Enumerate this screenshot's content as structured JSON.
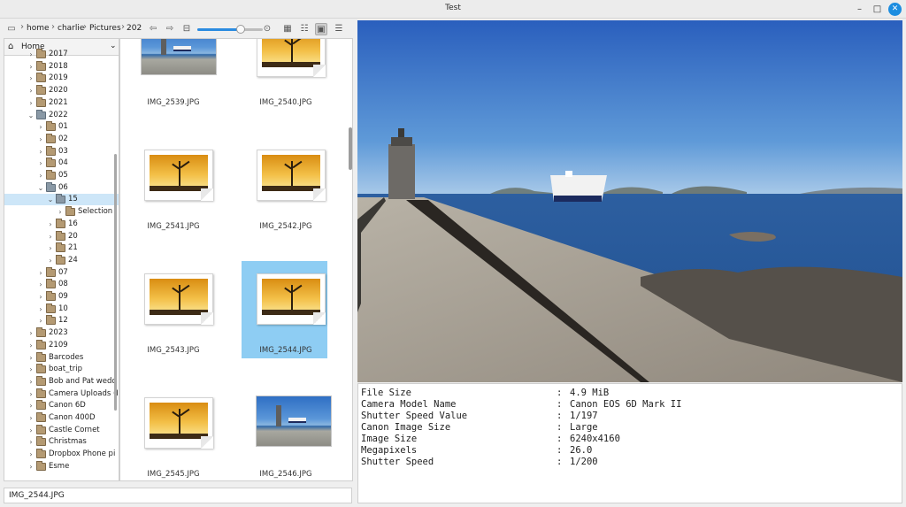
{
  "window": {
    "title": "Test"
  },
  "toolbar": {
    "breadcrumb": [
      "home",
      "charlie",
      "Pictures",
      "202"
    ],
    "zoom_percent": 66
  },
  "tree": {
    "home_label": "Home",
    "items": [
      {
        "label": "2017",
        "level": 0,
        "expanded": false,
        "selected": false
      },
      {
        "label": "2018",
        "level": 0,
        "expanded": false,
        "selected": false
      },
      {
        "label": "2019",
        "level": 0,
        "expanded": false,
        "selected": false
      },
      {
        "label": "2020",
        "level": 0,
        "expanded": false,
        "selected": false
      },
      {
        "label": "2021",
        "level": 0,
        "expanded": false,
        "selected": false
      },
      {
        "label": "2022",
        "level": 0,
        "expanded": true,
        "selected": false
      },
      {
        "label": "01",
        "level": 1,
        "expanded": false,
        "selected": false
      },
      {
        "label": "02",
        "level": 1,
        "expanded": false,
        "selected": false
      },
      {
        "label": "03",
        "level": 1,
        "expanded": false,
        "selected": false
      },
      {
        "label": "04",
        "level": 1,
        "expanded": false,
        "selected": false
      },
      {
        "label": "05",
        "level": 1,
        "expanded": false,
        "selected": false
      },
      {
        "label": "06",
        "level": 1,
        "expanded": true,
        "selected": false
      },
      {
        "label": "15",
        "level": 2,
        "expanded": true,
        "selected": true
      },
      {
        "label": "Selection",
        "level": 3,
        "expanded": false,
        "selected": false
      },
      {
        "label": "16",
        "level": 2,
        "expanded": false,
        "selected": false
      },
      {
        "label": "20",
        "level": 2,
        "expanded": false,
        "selected": false
      },
      {
        "label": "21",
        "level": 2,
        "expanded": false,
        "selected": false
      },
      {
        "label": "24",
        "level": 2,
        "expanded": false,
        "selected": false
      },
      {
        "label": "07",
        "level": 1,
        "expanded": false,
        "selected": false
      },
      {
        "label": "08",
        "level": 1,
        "expanded": false,
        "selected": false
      },
      {
        "label": "09",
        "level": 1,
        "expanded": false,
        "selected": false
      },
      {
        "label": "10",
        "level": 1,
        "expanded": false,
        "selected": false
      },
      {
        "label": "12",
        "level": 1,
        "expanded": false,
        "selected": false
      },
      {
        "label": "2023",
        "level": 0,
        "expanded": false,
        "selected": false
      },
      {
        "label": "2109",
        "level": 0,
        "expanded": false,
        "selected": false
      },
      {
        "label": "Barcodes",
        "level": 0,
        "expanded": false,
        "selected": false
      },
      {
        "label": "boat_trip",
        "level": 0,
        "expanded": false,
        "selected": false
      },
      {
        "label": "Bob and Pat wedd",
        "level": 0,
        "expanded": false,
        "selected": false
      },
      {
        "label": "Camera Uploads (I",
        "level": 0,
        "expanded": false,
        "selected": false
      },
      {
        "label": "Canon 6D",
        "level": 0,
        "expanded": false,
        "selected": false
      },
      {
        "label": "Canon 400D",
        "level": 0,
        "expanded": false,
        "selected": false
      },
      {
        "label": "Castle Cornet",
        "level": 0,
        "expanded": false,
        "selected": false
      },
      {
        "label": "Christmas",
        "level": 0,
        "expanded": false,
        "selected": false
      },
      {
        "label": "Dropbox Phone pi",
        "level": 0,
        "expanded": false,
        "selected": false
      },
      {
        "label": "Esme",
        "level": 0,
        "expanded": false,
        "selected": false
      }
    ]
  },
  "files": [
    {
      "name": "IMG_2539.JPG",
      "kind": "photo",
      "selected": false
    },
    {
      "name": "IMG_2540.JPG",
      "kind": "placeholder",
      "selected": false
    },
    {
      "name": "IMG_2541.JPG",
      "kind": "placeholder",
      "selected": false
    },
    {
      "name": "IMG_2542.JPG",
      "kind": "placeholder",
      "selected": false
    },
    {
      "name": "IMG_2543.JPG",
      "kind": "placeholder",
      "selected": false
    },
    {
      "name": "IMG_2544.JPG",
      "kind": "placeholder",
      "selected": true
    },
    {
      "name": "IMG_2545.JPG",
      "kind": "placeholder",
      "selected": false
    },
    {
      "name": "IMG_2546.JPG",
      "kind": "photo",
      "selected": false
    }
  ],
  "status": {
    "filename": "IMG_2544.JPG"
  },
  "exif": [
    {
      "key": "File Size",
      "value": "4.9 MiB"
    },
    {
      "key": "Camera Model Name",
      "value": "Canon EOS 6D Mark II"
    },
    {
      "key": "Shutter Speed Value",
      "value": "1/197"
    },
    {
      "key": "Canon Image Size",
      "value": "Large"
    },
    {
      "key": "Image Size",
      "value": "6240x4160"
    },
    {
      "key": "Megapixels",
      "value": "26.0"
    },
    {
      "key": "Shutter Speed",
      "value": "1/200"
    }
  ],
  "colors": {
    "accent": "#1c8de0",
    "selection": "#8ecdf3",
    "tree_selection": "#cde6f8"
  }
}
